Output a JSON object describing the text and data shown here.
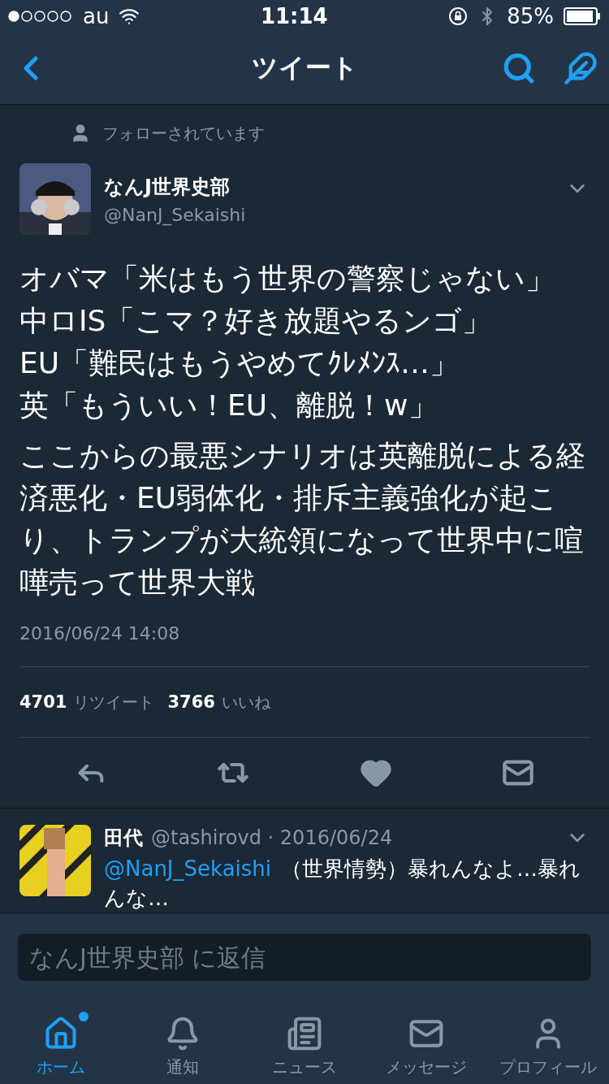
{
  "status_bar": {
    "carrier": "au",
    "time": "11:14",
    "battery": "85%"
  },
  "nav": {
    "title": "ツイート"
  },
  "tweet": {
    "followed_label": "フォローされています",
    "author": "なんJ世界史部",
    "handle": "@NanJ_Sekaishi",
    "lines": [
      "オバマ「米はもう世界の警察じゃない」",
      "中ロIS「こマ？好き放題やるンゴ」",
      "EU「難民はもうやめてｸﾚﾒﾝｽ…」",
      "英「もういい！EU、離脱！w」"
    ],
    "paragraph": "ここからの最悪シナリオは英離脱による経済悪化・EU弱体化・排斥主義強化が起こり、トランプが大統領になって世界中に喧嘩売って世界大戦",
    "timestamp": "2016/06/24 14:08",
    "stats": [
      {
        "count": "4701",
        "label": "リツイート"
      },
      {
        "count": "3766",
        "label": "いいね"
      }
    ],
    "actions": [
      {
        "kind": "reply"
      },
      {
        "kind": "retweet"
      },
      {
        "kind": "like"
      },
      {
        "kind": "message"
      }
    ]
  },
  "reply": {
    "author": "田代",
    "meta": "@tashirovd · 2016/06/24",
    "mention": "@NanJ_Sekaishi",
    "text": "（世界情勢）暴れんなよ…暴れんな…"
  },
  "reply_field": {
    "placeholder": "なんJ世界史部 に返信"
  },
  "tab_bar": [
    {
      "kind": "home",
      "label": "ホーム",
      "selected": true,
      "dot": true
    },
    {
      "kind": "notifications",
      "label": "通知",
      "selected": false,
      "dot": false
    },
    {
      "kind": "news",
      "label": "ニュース",
      "selected": false,
      "dot": false
    },
    {
      "kind": "messages",
      "label": "メッセージ",
      "selected": false,
      "dot": false
    },
    {
      "kind": "profile",
      "label": "プロフィール",
      "selected": false,
      "dot": false
    }
  ]
}
